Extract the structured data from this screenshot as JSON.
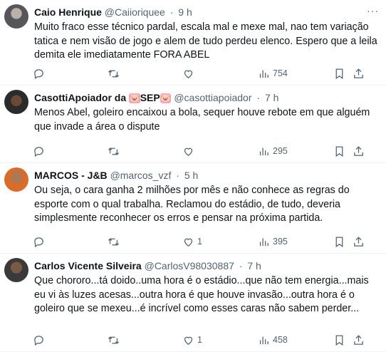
{
  "tweets": [
    {
      "display_name": "Caio Henrique",
      "handle": "@Caiioriquee",
      "separator": "·",
      "time": "9 h",
      "text_lines": [
        "Muito fraco esse técnico pardal, escala mal e mexe mal, nao tem variação",
        "tatica e nem visão de jogo e alem de tudo perdeu elenco. Espero que a leila",
        "demita ele imediatamente  FORA ABEL"
      ],
      "reply_count": "",
      "retweet_count": "",
      "like_count": "",
      "view_count": "754"
    },
    {
      "display_name": "CasottiApoiador da",
      "name_emoji_1": "🐷",
      "name_tag": "SEP",
      "name_emoji_2": "🐷",
      "handle": "@casottiapoiador",
      "separator": "·",
      "time": "7 h",
      "text_lines": [
        "Menos Abel, goleiro encaixou a bola, sequer houve rebote em que alguém",
        "que invade a área o dispute"
      ],
      "reply_count": "",
      "retweet_count": "",
      "like_count": "",
      "view_count": "295"
    },
    {
      "display_name": "MARCOS - J&B",
      "handle": "@marcos_vzf",
      "separator": "·",
      "time": "5 h",
      "text_lines": [
        "Ou seja, o cara ganha 2 milhões por mês e não conhece as regras do",
        "esporte com o qual trabalha. Reclamou do estádio, de tudo, deveria",
        "simplesmente reconhecer os erros e pensar na próxima partida."
      ],
      "reply_count": "",
      "retweet_count": "",
      "like_count": "1",
      "view_count": "395"
    },
    {
      "display_name": "Carlos Vicente Silveira",
      "handle": "@CarlosV98030887",
      "separator": "·",
      "time": "7 h",
      "text_lines": [
        "Que chororo...tá  doido..uma hora é o estádio...que não tem energia...mais",
        "eu vi às luzes acesas...outra hora é que houve invasão...outra hora é o",
        "goleiro que se mexeu...é incrível como esses caras não sabem perder..."
      ],
      "reply_count": "",
      "retweet_count": "",
      "like_count": "1",
      "view_count": "458"
    }
  ],
  "icons": {
    "more": "more-icon",
    "reply": "reply-icon",
    "retweet": "retweet-icon",
    "like": "like-icon",
    "views": "views-icon",
    "bookmark": "bookmark-icon",
    "share": "share-icon"
  },
  "colors": {
    "text": "#0f1419",
    "secondary": "#536471",
    "divider": "#eff3f4"
  }
}
